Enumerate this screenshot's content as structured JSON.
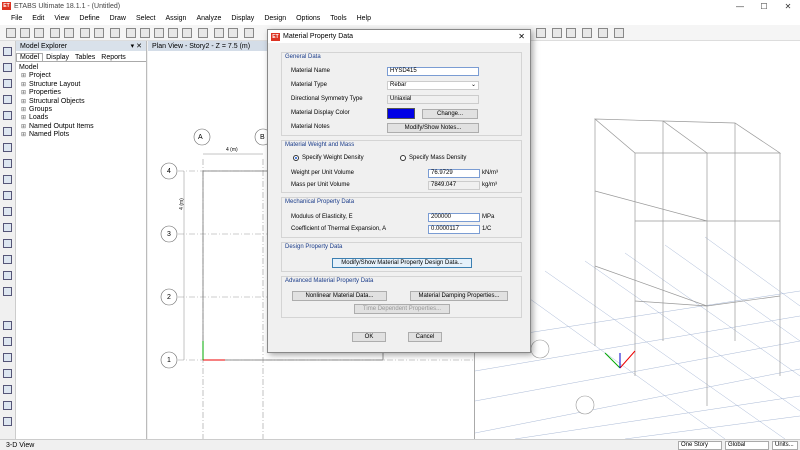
{
  "app": {
    "title": "ETABS Ultimate 18.1.1 - (Untitled)",
    "icon": "ET"
  },
  "window": {
    "minimize": "—",
    "maximize": "☐",
    "close": "✕"
  },
  "menu": [
    "File",
    "Edit",
    "View",
    "Define",
    "Draw",
    "Select",
    "Assign",
    "Analyze",
    "Display",
    "Design",
    "Options",
    "Tools",
    "Help"
  ],
  "explorer": {
    "title": "Model Explorer",
    "tabs": [
      "Model",
      "Display",
      "Tables",
      "Reports"
    ],
    "root": "Model",
    "nodes": [
      "Project",
      "Structure Layout",
      "Properties",
      "Structural Objects",
      "Groups",
      "Loads",
      "Named Output Items",
      "Named Plots"
    ]
  },
  "plan": {
    "tab": "Plan View - Story2 - Z = 7.5 (m)",
    "grid_cols": [
      "A",
      "B"
    ],
    "grid_rows": [
      "4",
      "3",
      "2",
      "1"
    ],
    "dim_top": "4 (m)",
    "dim_side": "4 (m)"
  },
  "view3d": {
    "tab": "3-D View"
  },
  "dialog": {
    "title": "Material Property Data",
    "general": {
      "heading": "General Data",
      "name_label": "Material Name",
      "name_value": "HYSD415",
      "type_label": "Material Type",
      "type_value": "Rebar",
      "symmetry_label": "Directional Symmetry Type",
      "symmetry_value": "Uniaxial",
      "color_label": "Material Display Color",
      "color_value": "#0000e6",
      "change_btn": "Change...",
      "notes_label": "Material Notes",
      "notes_btn": "Modify/Show Notes..."
    },
    "weight": {
      "heading": "Material Weight and Mass",
      "opt_weight": "Specify Weight Density",
      "opt_mass": "Specify Mass Density",
      "wpv_label": "Weight per Unit Volume",
      "wpv_value": "76.9729",
      "wpv_unit": "kN/m³",
      "mpv_label": "Mass per Unit Volume",
      "mpv_value": "7849.047",
      "mpv_unit": "kg/m³"
    },
    "mech": {
      "heading": "Mechanical Property Data",
      "e_label": "Modulus of Elasticity,  E",
      "e_value": "200000",
      "e_unit": "MPa",
      "a_label": "Coefficient of Thermal Expansion,  A",
      "a_value": "0.0000117",
      "a_unit": "1/C"
    },
    "design": {
      "heading": "Design Property Data",
      "btn": "Modify/Show Material Property Design Data..."
    },
    "advanced": {
      "heading": "Advanced Material Property Data",
      "nonlinear_btn": "Nonlinear Material Data...",
      "damping_btn": "Material Damping Properties...",
      "time_btn": "Time Dependent Properties..."
    },
    "ok": "OK",
    "cancel": "Cancel"
  },
  "status": {
    "left": "3-D View",
    "story": "One Story",
    "coord": "Global",
    "units": "Units..."
  }
}
